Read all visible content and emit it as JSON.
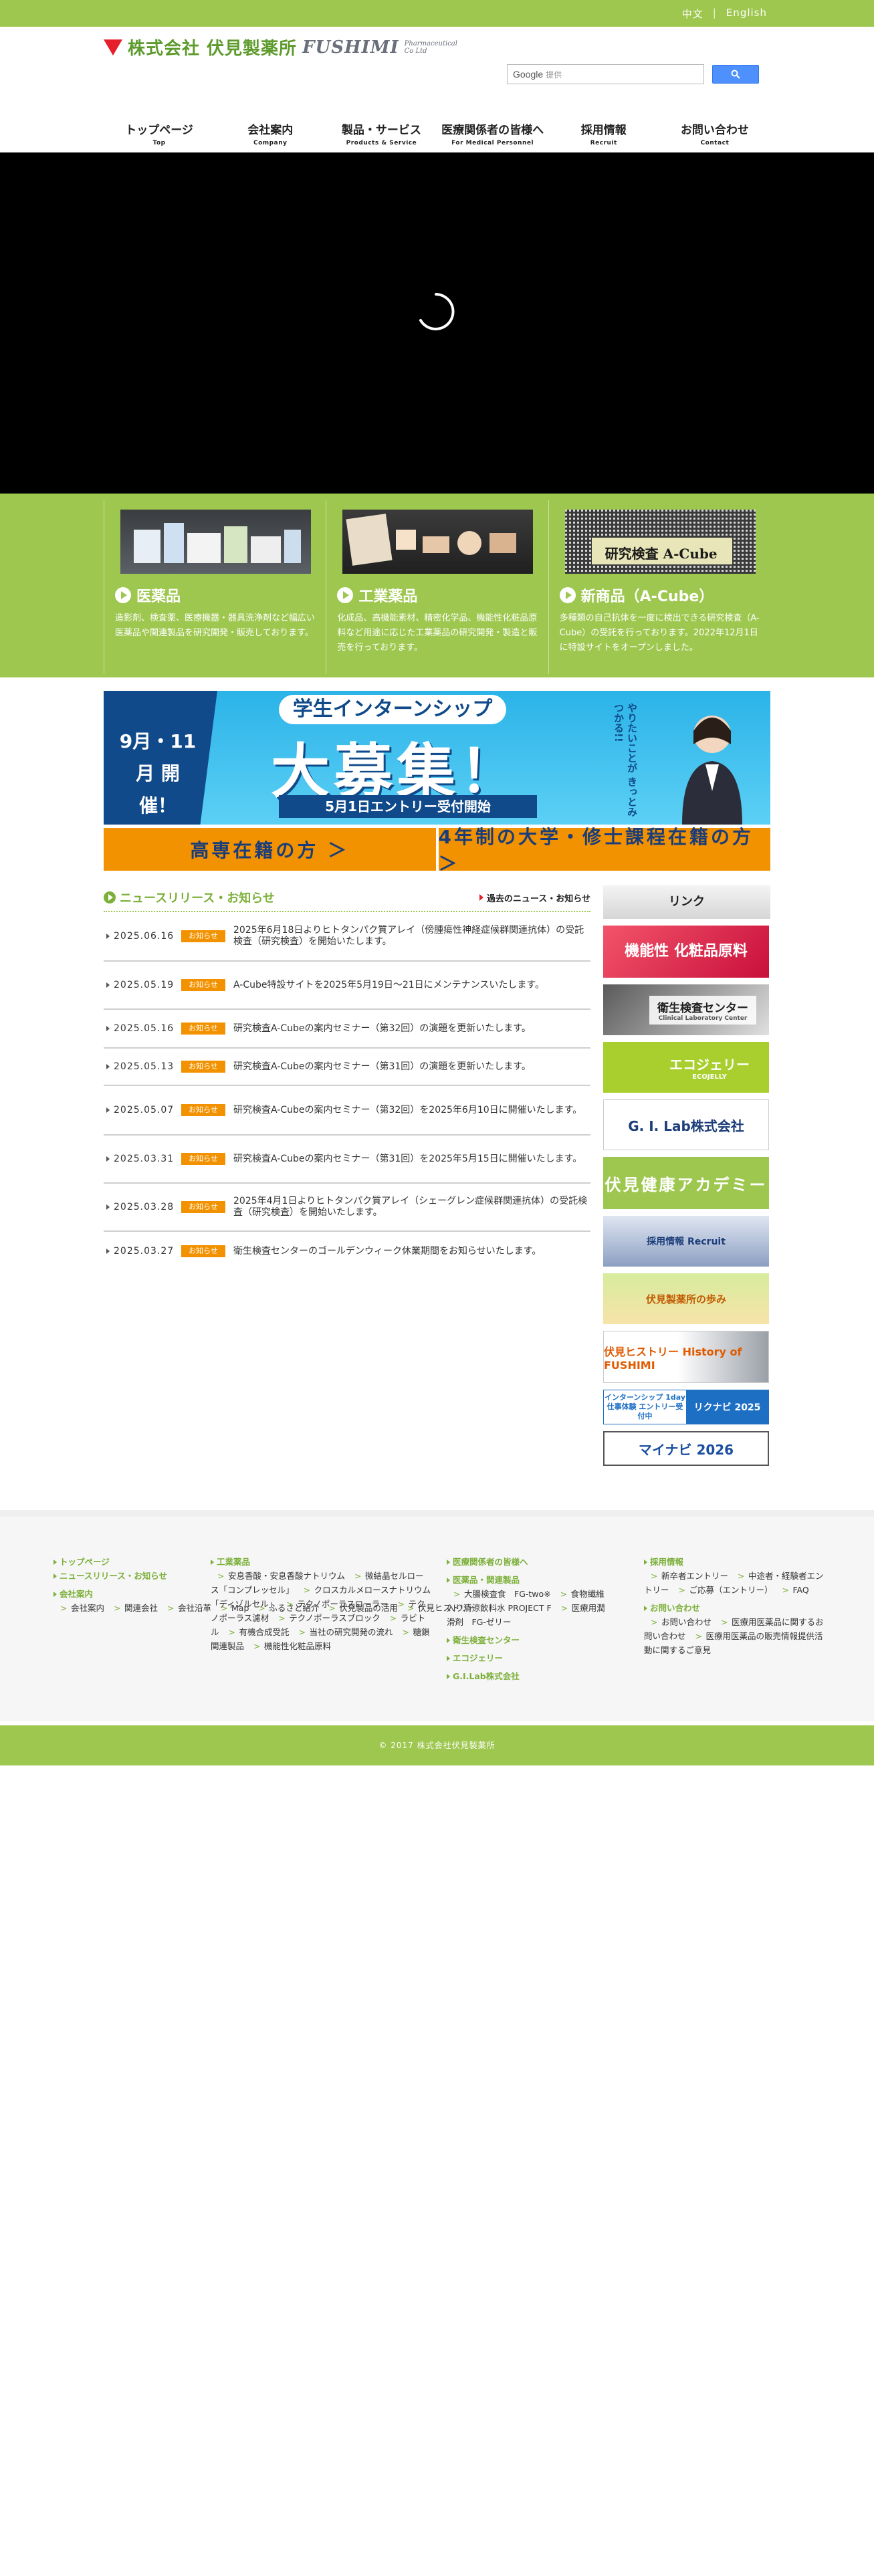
{
  "lang": {
    "chinese": "中文",
    "sep": "|",
    "english": "English"
  },
  "logo": {
    "jp": "株式会社 伏見製薬所",
    "en": "FUSHIMI",
    "en_sub": "Pharmaceutical Co Ltd"
  },
  "search": {
    "brand": "Google",
    "placeholder": "提供"
  },
  "nav": [
    {
      "jp": "トップページ",
      "en": "Top"
    },
    {
      "jp": "会社案内",
      "en": "Company"
    },
    {
      "jp": "製品・サービス",
      "en": "Products & Service"
    },
    {
      "jp": "医療関係者の皆様へ",
      "en": "For Medical Personnel"
    },
    {
      "jp": "採用情報",
      "en": "Recruit"
    },
    {
      "jp": "お問い合わせ",
      "en": "Contact"
    }
  ],
  "cards": [
    {
      "title": "医薬品",
      "desc": "造影剤、検査薬、医療機器・器具洗浄剤など幅広い医薬品や関連製品を研究開発・販売しております。"
    },
    {
      "title": "工業薬品",
      "desc": "化成品、高機能素材、精密化学品、機能性化粧品原料など用途に応じた工業薬品の研究開発・製造と販売を行っております。"
    },
    {
      "title": "新商品（A-Cube）",
      "desc": "多種類の自己抗体を一度に検出できる研究検査（A-Cube）の受託を行っております。2022年12月1日に特設サイトをオープンしました。",
      "img_text": "研究検査 A-Cube"
    }
  ],
  "intern": {
    "date": "9月・11月 開 催！",
    "sub": "学生インターンシップ",
    "main": "大募集！",
    "entry": "5月1日エントリー受付開始",
    "tag": "やりたいことが きっとみつかる!!",
    "btn1": "高専在籍の方 ＞",
    "btn2": "4年制の大学・修士課程在籍の方 ＞"
  },
  "news": {
    "title": "ニュースリリース・お知らせ",
    "more": "過去のニュース・お知らせ",
    "items": [
      {
        "date": "2025.06.16",
        "badge": "お知らせ",
        "text": "2025年6月18日よりヒトタンパク質アレイ（傍腫瘍性神経症候群関連抗体）の受託検査（研究検査）を開始いたします。"
      },
      {
        "date": "2025.05.19",
        "badge": "お知らせ",
        "text": "A-Cube特設サイトを2025年5月19日〜21日にメンテナンスいたします。"
      },
      {
        "date": "2025.05.16",
        "badge": "お知らせ",
        "text": "研究検査A-Cubeの案内セミナー（第32回）の演題を更新いたします。"
      },
      {
        "date": "2025.05.13",
        "badge": "お知らせ",
        "text": "研究検査A-Cubeの案内セミナー（第31回）の演題を更新いたします。"
      },
      {
        "date": "2025.05.07",
        "badge": "お知らせ",
        "text": "研究検査A-Cubeの案内セミナー（第32回）を2025年6月10日に開催いたします。"
      },
      {
        "date": "2025.03.31",
        "badge": "お知らせ",
        "text": "研究検査A-Cubeの案内セミナー（第31回）を2025年5月15日に開催いたします。"
      },
      {
        "date": "2025.03.28",
        "badge": "お知らせ",
        "text": "2025年4月1日よりヒトタンパク質アレイ（シェーグレン症候群関連抗体）の受託検査（研究検査）を開始いたします。"
      },
      {
        "date": "2025.03.27",
        "badge": "お知らせ",
        "text": "衛生検査センターのゴールデンウィーク休業期間をお知らせいたします。"
      }
    ]
  },
  "side": {
    "head": "リンク",
    "b1": "機能性 化粧品原料",
    "b2": "衛生検査センター",
    "b2_sub": "Clinical Laboratory Center",
    "b3": "エコジェリー",
    "b3_sub": "ECOJELLY",
    "b4": "G. I. Lab株式会社",
    "b5": "伏見健康アカデミー",
    "b6": "採用情報 Recruit",
    "b7": "伏見製薬所の歩み",
    "b8": "伏見ヒストリー History of FUSHIMI",
    "b9_l": "インターンシップ 1day仕事体験 エントリー受付中",
    "b9_r": "リクナビ 2025",
    "b10": "マイナビ 2026"
  },
  "footer": {
    "col1": {
      "top": "トップページ",
      "news": "ニュースリリース・お知らせ",
      "company": "会社案内",
      "items": [
        "会社案内",
        "関連会社",
        "会社沿革",
        "Map",
        "ふるさと紹介",
        "伏見製品の活用",
        "伏見ヒストリー"
      ]
    },
    "col2": {
      "head": "工業薬品",
      "items": [
        "安息香酸・安息香酸ナトリウム",
        "微結晶セルロース「コンプレッセル」",
        "クロスカルメロースナトリウム「ディゾルセル」",
        "テクノポーラスローラー",
        "テクノポーラス濾材",
        "テクノポーラスブロック",
        "ラビトル",
        "有機合成受託",
        "当社の研究開発の流れ",
        "糖鎖関連製品",
        "機能性化粧品原料"
      ]
    },
    "col3": {
      "head": "医療関係者の皆様へ",
      "sub_head": "医薬品・関連製品",
      "items": [
        "大腸検査食　FG-two※",
        "食物繊維入り清涼飲料水 PROJECT F",
        "医療用潤滑剤　FG-ゼリー"
      ],
      "head2": "衛生検査センター",
      "head3": "エコジェリー",
      "head4": "G.I.Lab株式会社"
    },
    "col4": {
      "head": "採用情報",
      "items": [
        "新卒者エントリー",
        "中途者・経験者エントリー",
        "ご応募（エントリー）",
        "FAQ"
      ],
      "head2": "お問い合わせ",
      "items2": [
        "お問い合わせ",
        "医療用医薬品に関するお問い合わせ",
        "医療用医薬品の販売情報提供活動に関するご意見"
      ]
    },
    "copyright": "© 2017 株式会社伏見製薬所"
  }
}
